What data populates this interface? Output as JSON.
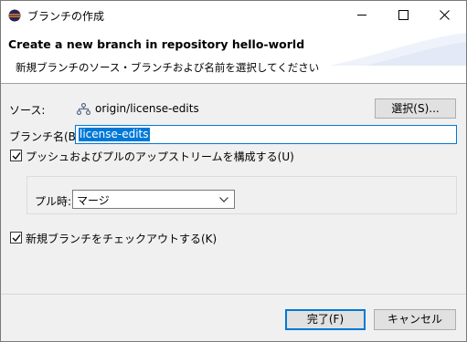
{
  "window": {
    "title": "ブランチの作成"
  },
  "banner": {
    "title": "Create a new branch in repository hello-world",
    "message": "新規ブランチのソース・ブランチおよび名前を選択してください"
  },
  "source": {
    "label": "ソース:",
    "value": "origin/license-edits",
    "select_button": "選択(S)..."
  },
  "branch_name": {
    "label": "ブランチ名(B):",
    "value": "license-edits"
  },
  "configure_upstream": {
    "label": "プッシュおよびプルのアップストリームを構成する(U)",
    "checked": true
  },
  "pull": {
    "label": "プル時:",
    "selected": "マージ"
  },
  "checkout": {
    "label": "新規ブランチをチェックアウトする(K)",
    "checked": true
  },
  "buttons": {
    "finish": "完了(F)",
    "cancel": "キャンセル"
  },
  "colors": {
    "accent": "#0078d7",
    "window_bg": "#f0f0f0"
  }
}
